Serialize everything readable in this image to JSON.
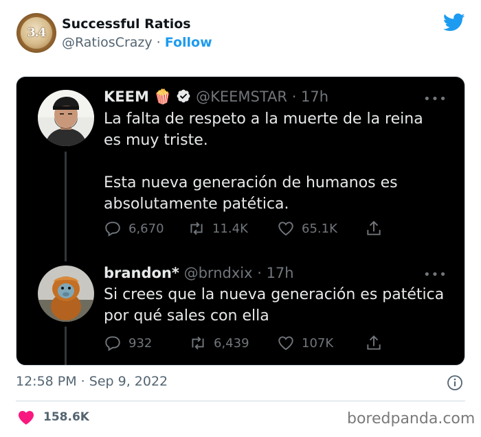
{
  "embed": {
    "author_name": "Successful Ratios",
    "author_handle": "@RatiosCrazy",
    "separator": "·",
    "follow_label": "Follow",
    "avatar_text": "3.4",
    "timestamp": "12:58 PM · Sep 9, 2022",
    "likes_count": "158.6K",
    "watermark": "boredpanda.com"
  },
  "tweets": [
    {
      "name": "KEEM",
      "emoji": "🍿",
      "handle": "@KEEMSTAR",
      "time": "· 17h",
      "more": "•••",
      "text": "La falta de respeto a la muerte de la reina\nes muy triste.\n\nEsta nueva generación de humanos es\nabsolutamente patética.",
      "replies": "6,670",
      "retweets": "11.4K",
      "likes": "65.1K"
    },
    {
      "name": "brandon*",
      "handle": "@brndxix",
      "time": "· 17h",
      "more": "•••",
      "text": "Si crees que la nueva generación es patética\npor qué sales con ella",
      "replies": "932",
      "retweets": "6,439",
      "likes": "107K"
    }
  ],
  "colors": {
    "brand_blue": "#1d9bf0",
    "like_pink": "#f91880",
    "card_bg": "#000000",
    "verified": "#ffffff"
  },
  "icons": [
    "twitter-bird-icon",
    "verified-badge-icon",
    "reply-icon",
    "retweet-icon",
    "like-icon",
    "share-icon",
    "info-icon",
    "heart-icon"
  ]
}
